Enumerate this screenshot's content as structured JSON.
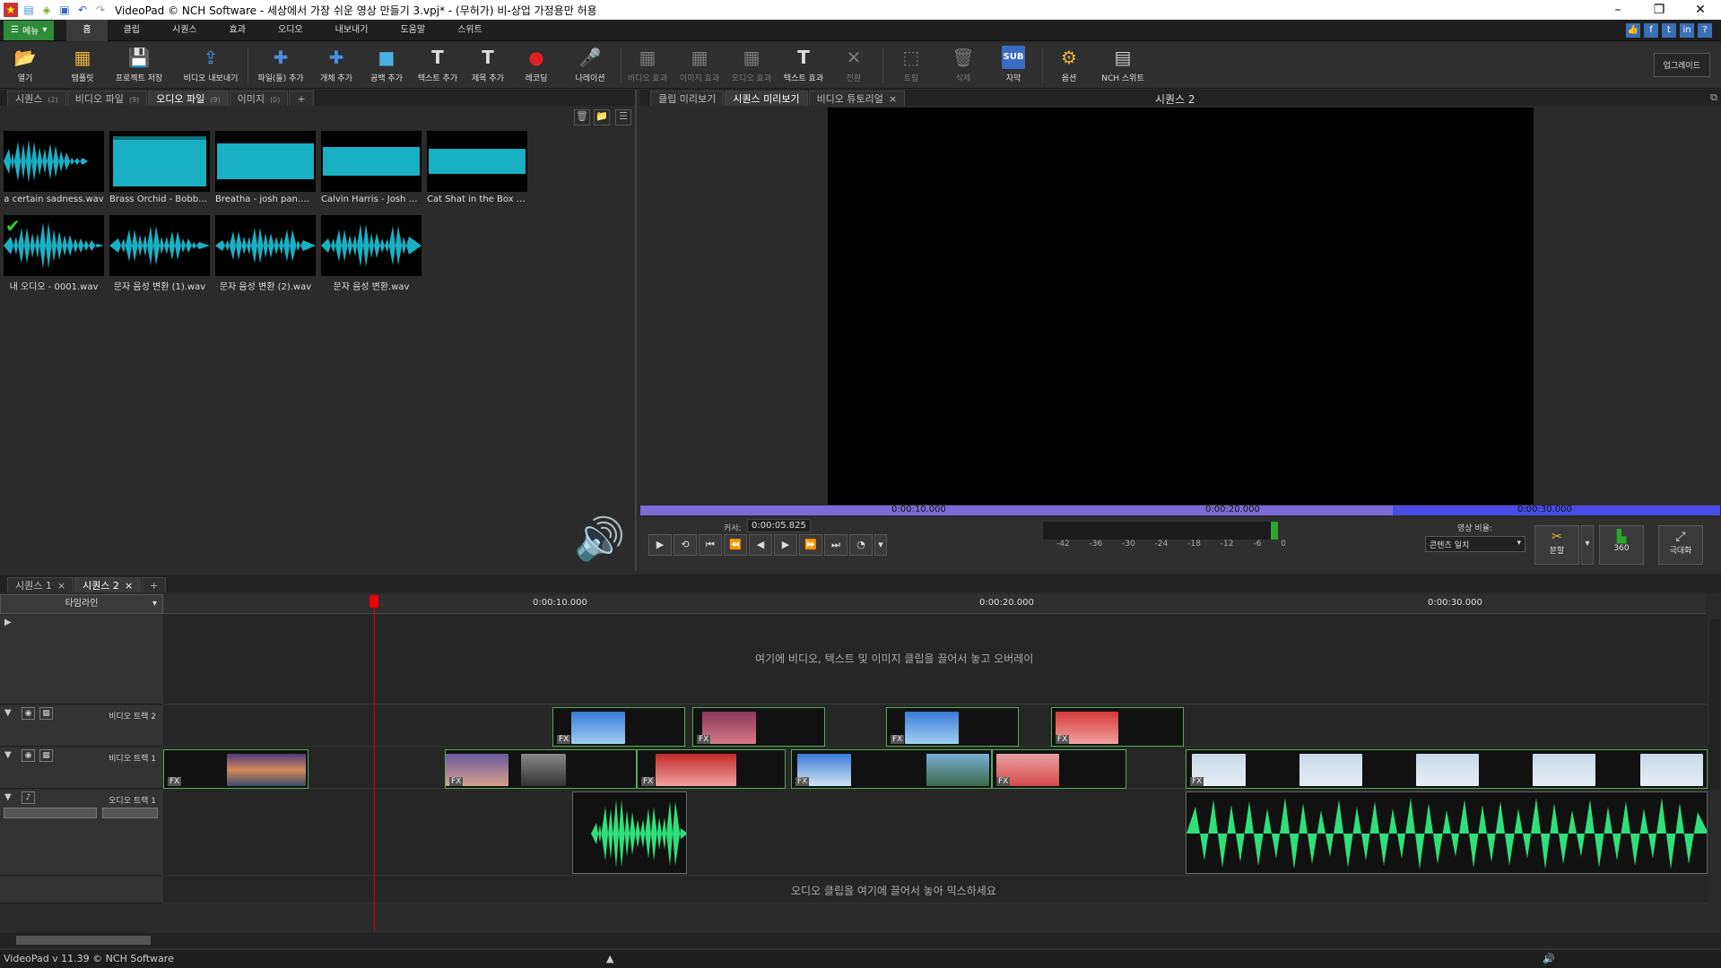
{
  "window": {
    "title": "VideoPad © NCH Software - 세상에서 가장 쉬운 영상 만들기 3.vpj* - (무허가) 비-상업 가정용만 허용",
    "controls": [
      "–",
      "❐",
      "✕"
    ]
  },
  "menu": {
    "main_button": "메뉴",
    "tabs": [
      "홈",
      "클립",
      "시퀀스",
      "효과",
      "오디오",
      "내보내기",
      "도움말",
      "스위트"
    ]
  },
  "toolbar": {
    "buttons": [
      "열기",
      "템플릿",
      "프로젝트 저장",
      "비디오 내보내기",
      "파일(들) 추가",
      "개체 추가",
      "공백 추가",
      "텍스트 추가",
      "제목 추가",
      "레코딩",
      "나레이션",
      "비디오 효과",
      "이미지 효과",
      "오디오 효과",
      "텍스트 효과",
      "전환",
      "트림",
      "삭제",
      "자막",
      "옵션",
      "NCH 스위트"
    ],
    "sub_icon_text": "SUB",
    "upgrade": "업그레이드"
  },
  "left_panel": {
    "tabs": [
      {
        "label": "시퀀스",
        "badge": "(2)"
      },
      {
        "label": "비디오 파일",
        "badge": "(9)"
      },
      {
        "label": "오디오 파일",
        "badge": "(9)"
      },
      {
        "label": "이미지",
        "badge": "(0)"
      },
      {
        "label": "+",
        "badge": ""
      }
    ],
    "media": [
      "a certain sadness.wav",
      "Brass Orchid - Bobby ...",
      "Breatha - josh pan.mp3",
      "Calvin Harris - Josh p...",
      "Cat Shat in the Box - J...",
      "내 오디오 - 0001.wav",
      "문자 음성 변환 (1).wav",
      "문자 음성 변환 (2).wav",
      "문자 음성 변환.wav"
    ]
  },
  "preview": {
    "tabs": [
      "클립 미리보기",
      "시퀀스 미리보기",
      "비디오 튜토리얼"
    ],
    "sequence_label": "시퀀스 2",
    "scrub_times": [
      "0:00:10.000",
      "0:00:20.000",
      "0:00:30.000"
    ],
    "cursor_label": "커서:",
    "cursor_value": "0:00:05.825",
    "meter_scale": "-42 -36 -30 -24 -18 -12 -6 0",
    "ratio_label": "영상 비율:",
    "ratio_value": "콘텐츠 일치",
    "split_label": "분할",
    "vr_label": "360",
    "fullscreen_label": "극대화"
  },
  "timeline": {
    "tabs": [
      "시퀀스 1",
      "시퀀스 2"
    ],
    "dropdown": "타임라인",
    "ruler": [
      "0:00:10.000",
      "0:00:20.000",
      "0:00:30.000"
    ],
    "overlay_hint": "여기에 비디오, 텍스트 및 이미지 클립을 끌어서 놓고 오버레이",
    "audio_hint": "오디오 클립을 여기에 끌어서 놓아 믹스하세요",
    "tracks": [
      "비디오 트랙 2",
      "비디오 트랙 1",
      "오디오 트랙 1"
    ]
  },
  "status": {
    "version": "VideoPad v 11.39 © NCH Software"
  },
  "colors": {
    "accent_green": "#2e8b3a",
    "wave_cyan": "#1ab0c4",
    "wave_green": "#2fe07a",
    "scrub_purple": "#7b6cd8",
    "playhead": "#d00000"
  }
}
